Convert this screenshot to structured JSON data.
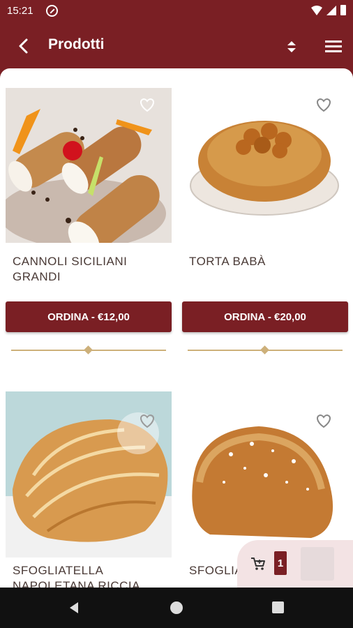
{
  "status_bar": {
    "time": "15:21"
  },
  "app_bar": {
    "title": "Prodotti"
  },
  "products": [
    {
      "name": "CANNOLI SICILIANI GRANDI",
      "button_label": "ORDINA - €12,00"
    },
    {
      "name": "TORTA BABÀ",
      "button_label": "ORDINA - €20,00"
    },
    {
      "name": "SFOGLIATELLA NAPOLETANA RICCIA",
      "button_label": ""
    },
    {
      "name": "SFOGLIA",
      "button_label": ""
    }
  ],
  "cart": {
    "count": "1"
  },
  "icons": [
    "back-arrow-icon",
    "sort-icon",
    "menu-icon",
    "heart-icon",
    "cart-icon"
  ],
  "colors": {
    "primary": "#7a1f24",
    "accent_gold": "#cdb07a",
    "cart_panel": "#f3e3e4"
  }
}
